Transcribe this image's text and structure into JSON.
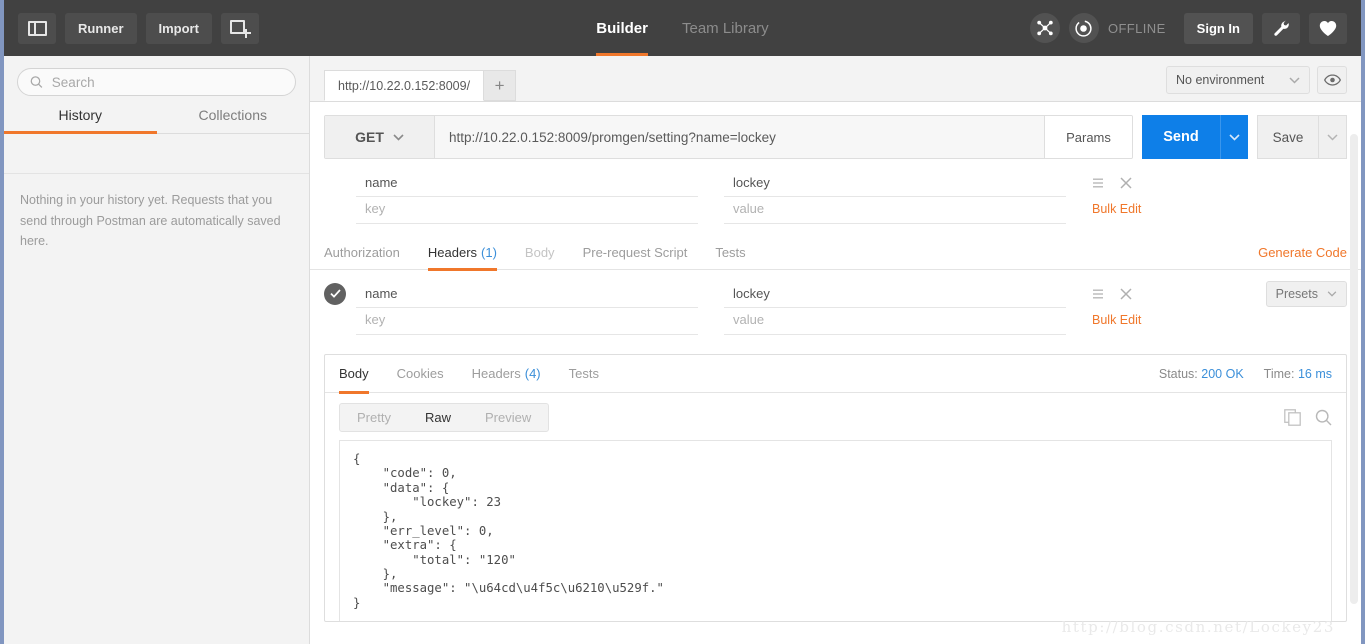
{
  "header": {
    "sidebar_toggle_icon": "sidebar-toggle-icon",
    "runner_label": "Runner",
    "import_label": "Import",
    "new_tab_icon": "new-window-icon",
    "tabs": [
      {
        "label": "Builder",
        "active": true
      },
      {
        "label": "Team Library",
        "active": false
      }
    ],
    "sync_icon": "scatter-node-icon",
    "status_icon": "circle-dot-icon",
    "status_label": "OFFLINE",
    "sign_in_label": "Sign In",
    "wrench_icon": "wrench-icon",
    "heart_icon": "heart-icon"
  },
  "sidebar": {
    "search_placeholder": "Search",
    "search_value": "",
    "search_icon": "search-icon",
    "tabs": [
      {
        "label": "History",
        "active": true
      },
      {
        "label": "Collections",
        "active": false
      }
    ],
    "empty_message": "Nothing in your history yet. Requests that you send through Postman are automatically saved here."
  },
  "tabbar": {
    "request_tab_label": "http://10.22.0.152:8009/",
    "add_tab_label": "+",
    "environment_value": "No environment",
    "environment_caret_icon": "chevron-down-icon",
    "eye_icon": "eye-icon"
  },
  "request": {
    "method": "GET",
    "method_caret_icon": "chevron-down-icon",
    "url": "http://10.22.0.152:8009/promgen/setting?name=lockey",
    "params_label": "Params",
    "send_label": "Send",
    "send_caret_icon": "chevron-down-icon",
    "save_label": "Save",
    "save_caret_icon": "chevron-down-icon",
    "params_rows": [
      {
        "key": "name",
        "value": "lockey",
        "placeholder": false
      },
      {
        "key": "key",
        "value": "value",
        "placeholder": true
      }
    ],
    "row_menu_icon": "list-menu-icon",
    "row_delete_icon": "close-icon",
    "bulk_edit_label": "Bulk Edit",
    "tabs": [
      {
        "label": "Authorization",
        "active": false,
        "dim": false,
        "count": ""
      },
      {
        "label": "Headers",
        "active": true,
        "dim": false,
        "count": "(1)"
      },
      {
        "label": "Body",
        "active": false,
        "dim": true,
        "count": ""
      },
      {
        "label": "Pre-request Script",
        "active": false,
        "dim": false,
        "count": ""
      },
      {
        "label": "Tests",
        "active": false,
        "dim": false,
        "count": ""
      }
    ],
    "generate_code_label": "Generate Code",
    "header_rows": [
      {
        "key": "name",
        "value": "lockey",
        "placeholder": false,
        "checked": true
      },
      {
        "key": "key",
        "value": "value",
        "placeholder": true,
        "checked": false
      }
    ],
    "presets_label": "Presets",
    "presets_caret_icon": "chevron-down-icon",
    "checkbox_icon": "check-icon"
  },
  "response": {
    "tabs": [
      {
        "label": "Body",
        "active": true,
        "count": ""
      },
      {
        "label": "Cookies",
        "active": false,
        "count": ""
      },
      {
        "label": "Headers",
        "active": false,
        "count": "(4)"
      },
      {
        "label": "Tests",
        "active": false,
        "count": ""
      }
    ],
    "status_label": "Status:",
    "status_value": "200 OK",
    "time_label": "Time:",
    "time_value": "16 ms",
    "view_modes": [
      {
        "label": "Pretty",
        "active": false
      },
      {
        "label": "Raw",
        "active": true
      },
      {
        "label": "Preview",
        "active": false
      }
    ],
    "copy_icon": "copy-icon",
    "search_icon": "search-icon",
    "body_text": "{\n    \"code\": 0,\n    \"data\": {\n        \"lockey\": 23\n    },\n    \"err_level\": 0,\n    \"extra\": {\n        \"total\": \"120\"\n    },\n    \"message\": \"\\u64cd\\u4f5c\\u6210\\u529f.\"\n}"
  },
  "watermark": {
    "text": "http://blog.csdn.net/Lockey23"
  },
  "colors": {
    "accent_orange": "#f0772b",
    "accent_blue": "#0e7fe8",
    "header_bg": "#414141",
    "link_blue": "#3b8fd9"
  }
}
